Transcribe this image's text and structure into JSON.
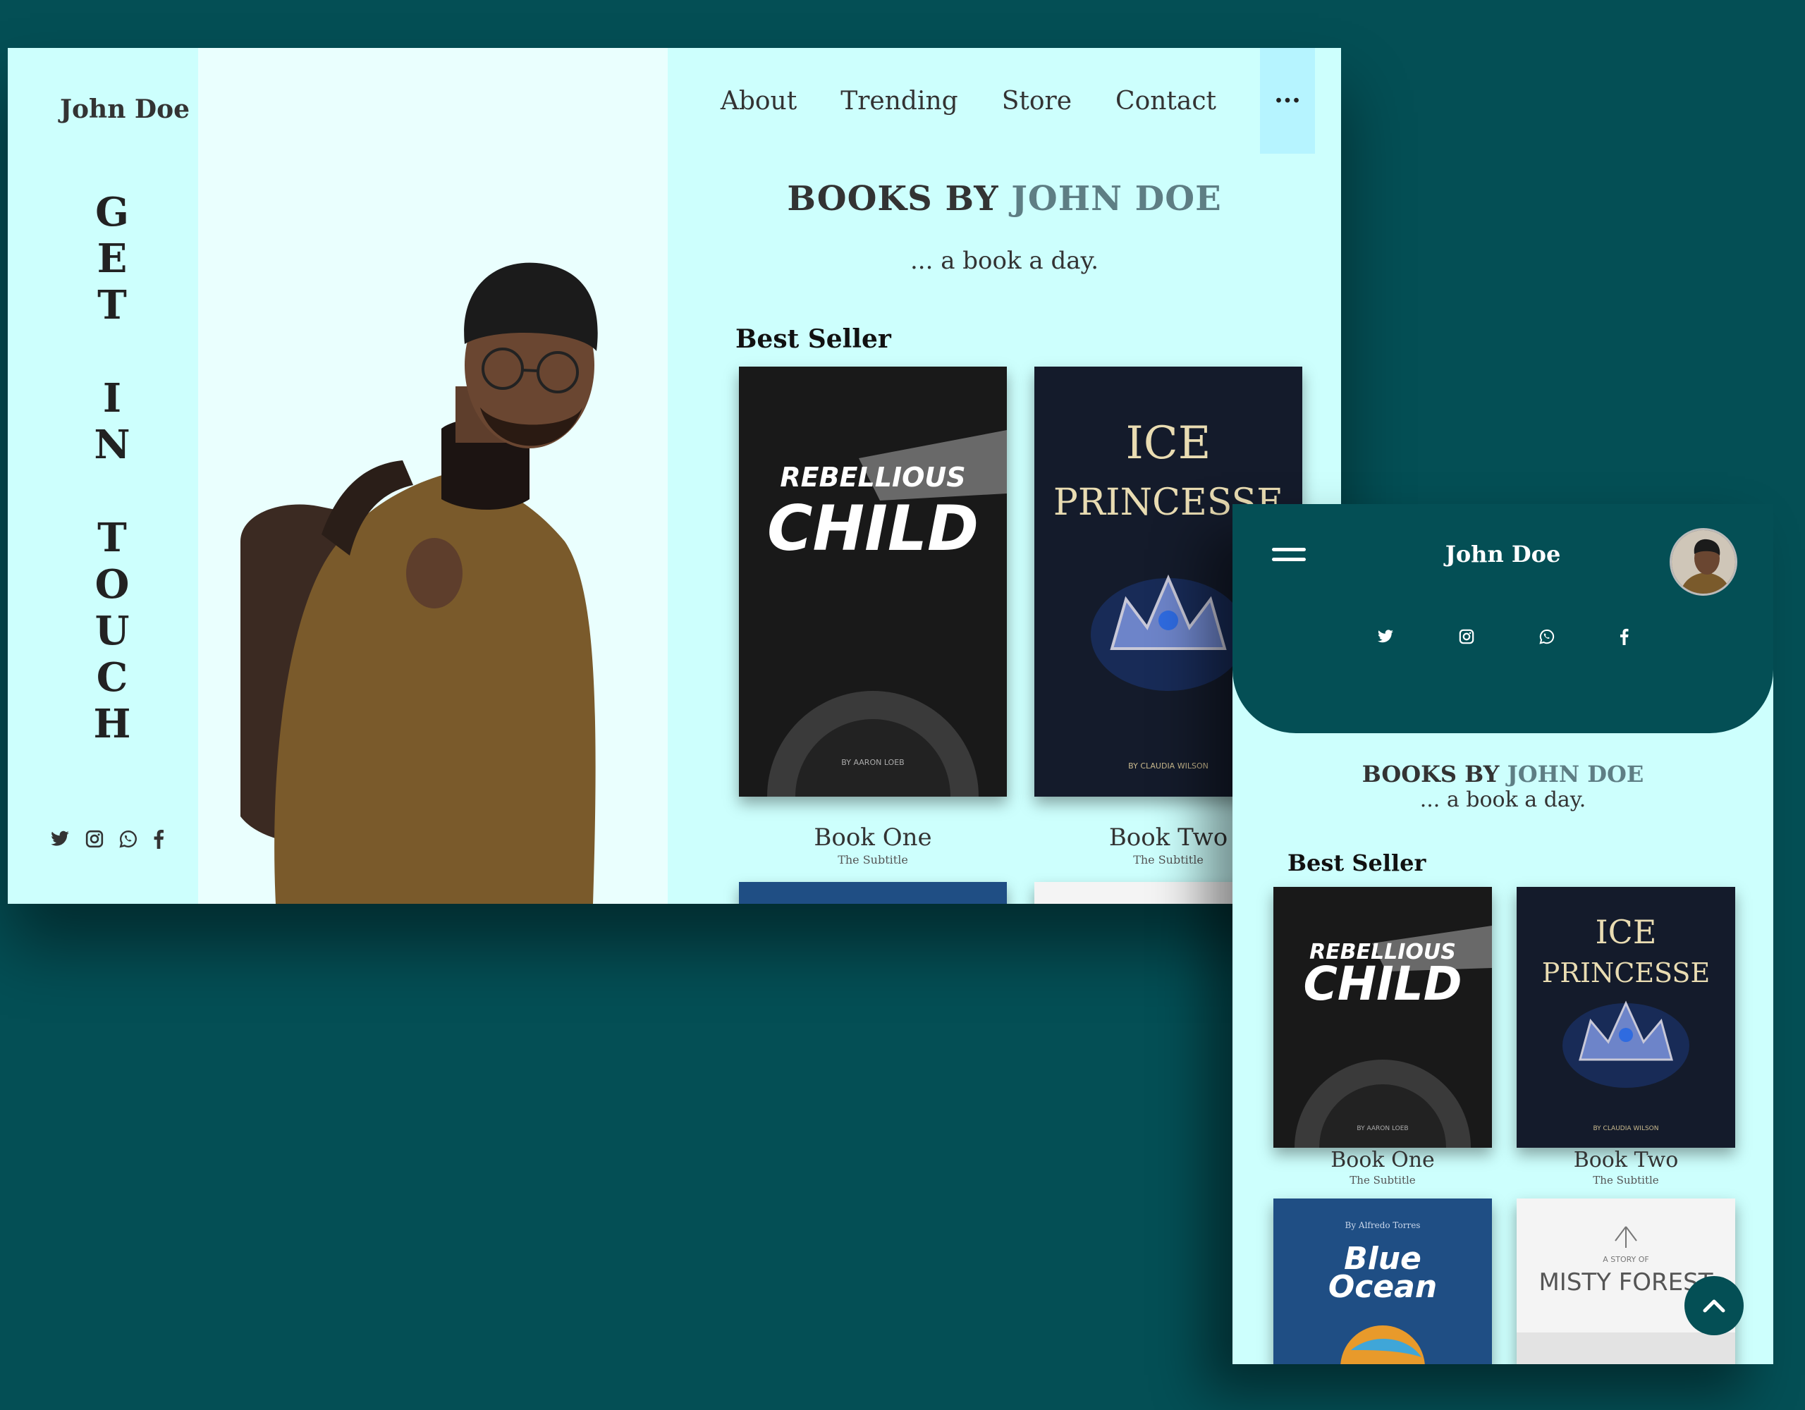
{
  "desktop": {
    "brand": "John Doe",
    "vertical_cta": [
      "G",
      "E",
      "T",
      "",
      "I",
      "N",
      "",
      "T",
      "O",
      "U",
      "C",
      "H"
    ],
    "nav": {
      "items": [
        "About",
        "Trending",
        "Store",
        "Contact"
      ],
      "more": "···"
    },
    "heading": {
      "prefix": "BOOKS BY ",
      "accent": "JOHN DOE"
    },
    "tagline": "... a book a day.",
    "section_title": "Best Seller",
    "books": [
      {
        "title": "Book One",
        "subtitle": "The Subtitle",
        "cover_line1": "REBELLIOUS",
        "cover_line2": "CHILD",
        "cover_author": "BY AARON LOEB"
      },
      {
        "title": "Book Two",
        "subtitle": "The Subtitle",
        "cover_line1": "ICE",
        "cover_line2": "PRINCESSE",
        "cover_author": "BY CLAUDIA WILSON"
      }
    ],
    "social_icons": [
      "twitter-icon",
      "instagram-icon",
      "whatsapp-icon",
      "facebook-icon"
    ]
  },
  "mobile": {
    "brand": "John Doe",
    "heading": {
      "prefix": "BOOKS BY ",
      "accent": "JOHN DOE"
    },
    "tagline": "... a book a day.",
    "section_title": "Best Seller",
    "books": [
      {
        "title": "Book One",
        "subtitle": "The Subtitle",
        "cover_line1": "REBELLIOUS",
        "cover_line2": "CHILD",
        "cover_author": "BY AARON LOEB"
      },
      {
        "title": "Book Two",
        "subtitle": "The Subtitle",
        "cover_line1": "ICE",
        "cover_line2": "PRINCESSE",
        "cover_author": "BY CLAUDIA WILSON"
      },
      {
        "cover_author": "By Alfredo Torres",
        "cover_line1": "Blue",
        "cover_line2": "Ocean"
      },
      {
        "cover_author": "A STORY OF",
        "cover_line1": "MISTY FOREST"
      }
    ],
    "social_icons": [
      "twitter-icon",
      "instagram-icon",
      "whatsapp-icon",
      "facebook-icon"
    ]
  },
  "colors": {
    "background": "#044f55",
    "panel": "#cdfffd",
    "accent_text": "#5e7e84",
    "more_button": "#b6f4ff"
  }
}
